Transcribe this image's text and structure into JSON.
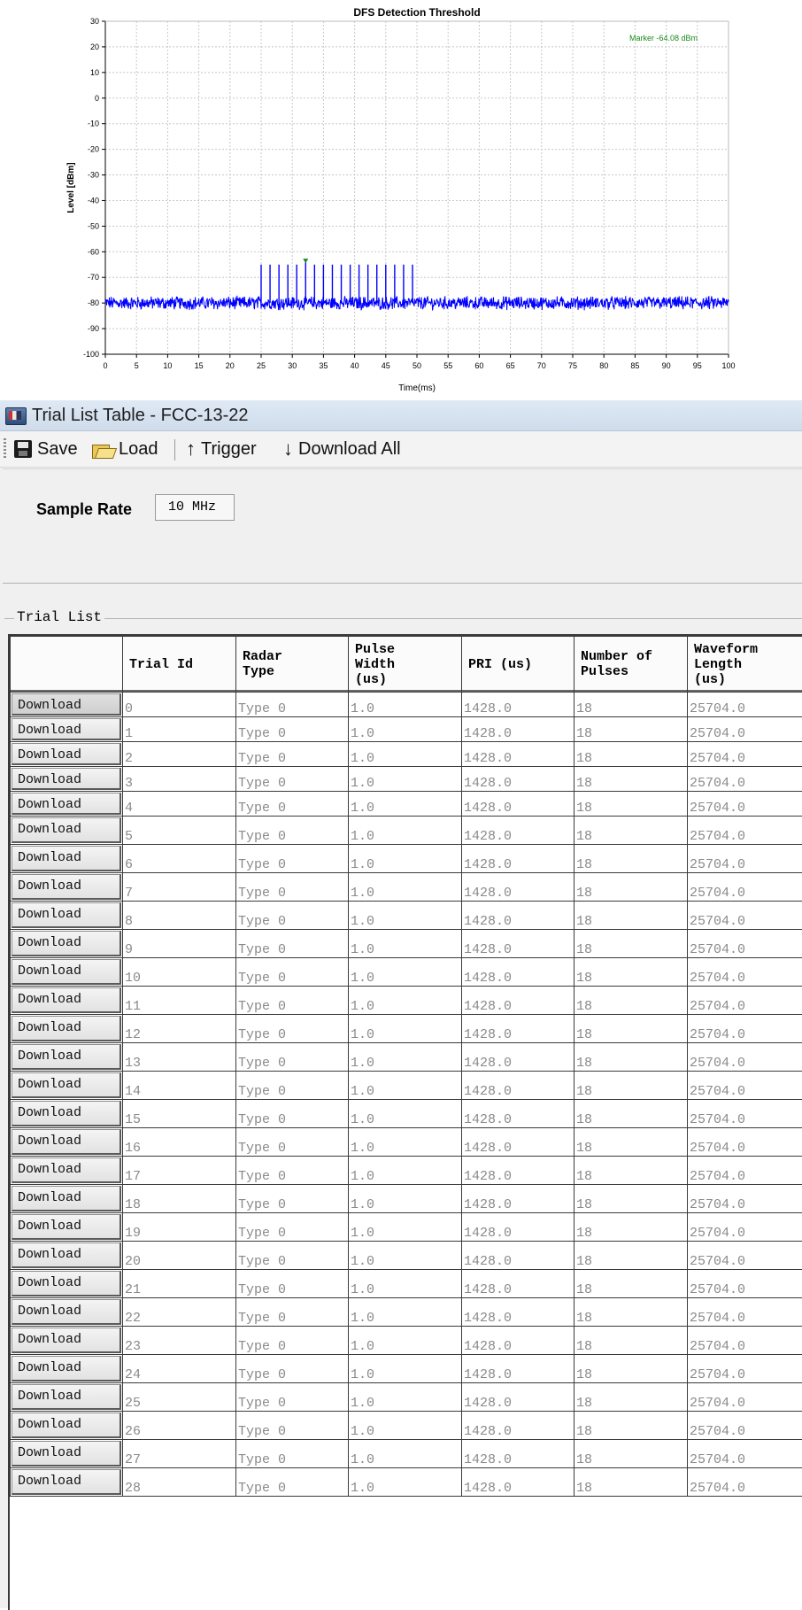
{
  "chart_data": {
    "type": "line",
    "title": "DFS Detection Threshold",
    "xlabel": "Time(ms)",
    "ylabel": "Level [dBm]",
    "xlim": [
      0,
      100
    ],
    "ylim": [
      -100,
      30
    ],
    "x_ticks": [
      0,
      5,
      10,
      15,
      20,
      25,
      30,
      35,
      40,
      45,
      50,
      55,
      60,
      65,
      70,
      75,
      80,
      85,
      90,
      95,
      100
    ],
    "y_ticks": [
      30,
      20,
      10,
      0,
      -10,
      -20,
      -30,
      -40,
      -50,
      -60,
      -70,
      -80,
      -90,
      -100
    ],
    "grid": true,
    "noise_floor_dbm": -80,
    "series": [
      {
        "color": "#0000ff",
        "pulses": [
          {
            "x": 25.0,
            "y": -65
          },
          {
            "x": 26.43,
            "y": -65
          },
          {
            "x": 27.86,
            "y": -65
          },
          {
            "x": 29.29,
            "y": -65
          },
          {
            "x": 30.71,
            "y": -65
          },
          {
            "x": 32.14,
            "y": -64.08
          },
          {
            "x": 33.57,
            "y": -65
          },
          {
            "x": 35.0,
            "y": -65
          },
          {
            "x": 36.43,
            "y": -65
          },
          {
            "x": 37.86,
            "y": -65
          },
          {
            "x": 39.29,
            "y": -65
          },
          {
            "x": 40.71,
            "y": -65
          },
          {
            "x": 42.14,
            "y": -65
          },
          {
            "x": 43.57,
            "y": -65
          },
          {
            "x": 45.0,
            "y": -65
          },
          {
            "x": 46.43,
            "y": -65
          },
          {
            "x": 47.86,
            "y": -65
          },
          {
            "x": 49.29,
            "y": -65
          }
        ]
      }
    ],
    "marker": {
      "x": 32.14,
      "y": -64.08,
      "label": "Marker -64.08 dBm",
      "color": "#1a8a1a"
    }
  },
  "window": {
    "title": "Trial List Table - FCC-13-22",
    "toolbar": {
      "save_label": "Save",
      "load_label": "Load",
      "trigger_label": "Trigger",
      "download_all_label": "Download All"
    },
    "sample_rate_label": "Sample Rate",
    "sample_rate_value": "10 MHz",
    "group_label": "Trial List",
    "table": {
      "headers": [
        "",
        "Trial Id",
        "Radar\nType",
        "Pulse\nWidth\n(us)",
        "PRI (us)",
        "Number of\nPulses",
        "Waveform\nLength\n(us)"
      ],
      "button_label": "Download",
      "rows": [
        [
          "0",
          "Type 0",
          "1.0",
          "1428.0",
          "18",
          "25704.0"
        ],
        [
          "1",
          "Type 0",
          "1.0",
          "1428.0",
          "18",
          "25704.0"
        ],
        [
          "2",
          "Type 0",
          "1.0",
          "1428.0",
          "18",
          "25704.0"
        ],
        [
          "3",
          "Type 0",
          "1.0",
          "1428.0",
          "18",
          "25704.0"
        ],
        [
          "4",
          "Type 0",
          "1.0",
          "1428.0",
          "18",
          "25704.0"
        ],
        [
          "5",
          "Type 0",
          "1.0",
          "1428.0",
          "18",
          "25704.0"
        ],
        [
          "6",
          "Type 0",
          "1.0",
          "1428.0",
          "18",
          "25704.0"
        ],
        [
          "7",
          "Type 0",
          "1.0",
          "1428.0",
          "18",
          "25704.0"
        ],
        [
          "8",
          "Type 0",
          "1.0",
          "1428.0",
          "18",
          "25704.0"
        ],
        [
          "9",
          "Type 0",
          "1.0",
          "1428.0",
          "18",
          "25704.0"
        ],
        [
          "10",
          "Type 0",
          "1.0",
          "1428.0",
          "18",
          "25704.0"
        ],
        [
          "11",
          "Type 0",
          "1.0",
          "1428.0",
          "18",
          "25704.0"
        ],
        [
          "12",
          "Type 0",
          "1.0",
          "1428.0",
          "18",
          "25704.0"
        ],
        [
          "13",
          "Type 0",
          "1.0",
          "1428.0",
          "18",
          "25704.0"
        ],
        [
          "14",
          "Type 0",
          "1.0",
          "1428.0",
          "18",
          "25704.0"
        ],
        [
          "15",
          "Type 0",
          "1.0",
          "1428.0",
          "18",
          "25704.0"
        ],
        [
          "16",
          "Type 0",
          "1.0",
          "1428.0",
          "18",
          "25704.0"
        ],
        [
          "17",
          "Type 0",
          "1.0",
          "1428.0",
          "18",
          "25704.0"
        ],
        [
          "18",
          "Type 0",
          "1.0",
          "1428.0",
          "18",
          "25704.0"
        ],
        [
          "19",
          "Type 0",
          "1.0",
          "1428.0",
          "18",
          "25704.0"
        ],
        [
          "20",
          "Type 0",
          "1.0",
          "1428.0",
          "18",
          "25704.0"
        ],
        [
          "21",
          "Type 0",
          "1.0",
          "1428.0",
          "18",
          "25704.0"
        ],
        [
          "22",
          "Type 0",
          "1.0",
          "1428.0",
          "18",
          "25704.0"
        ],
        [
          "23",
          "Type 0",
          "1.0",
          "1428.0",
          "18",
          "25704.0"
        ],
        [
          "24",
          "Type 0",
          "1.0",
          "1428.0",
          "18",
          "25704.0"
        ],
        [
          "25",
          "Type 0",
          "1.0",
          "1428.0",
          "18",
          "25704.0"
        ],
        [
          "26",
          "Type 0",
          "1.0",
          "1428.0",
          "18",
          "25704.0"
        ],
        [
          "27",
          "Type 0",
          "1.0",
          "1428.0",
          "18",
          "25704.0"
        ],
        [
          "28",
          "Type 0",
          "1.0",
          "1428.0",
          "18",
          "25704.0"
        ]
      ]
    }
  },
  "icons": {
    "save": "floppy-disk-icon",
    "load": "open-folder-icon",
    "trigger": "up-arrow-icon",
    "download_all": "down-arrow-icon"
  }
}
